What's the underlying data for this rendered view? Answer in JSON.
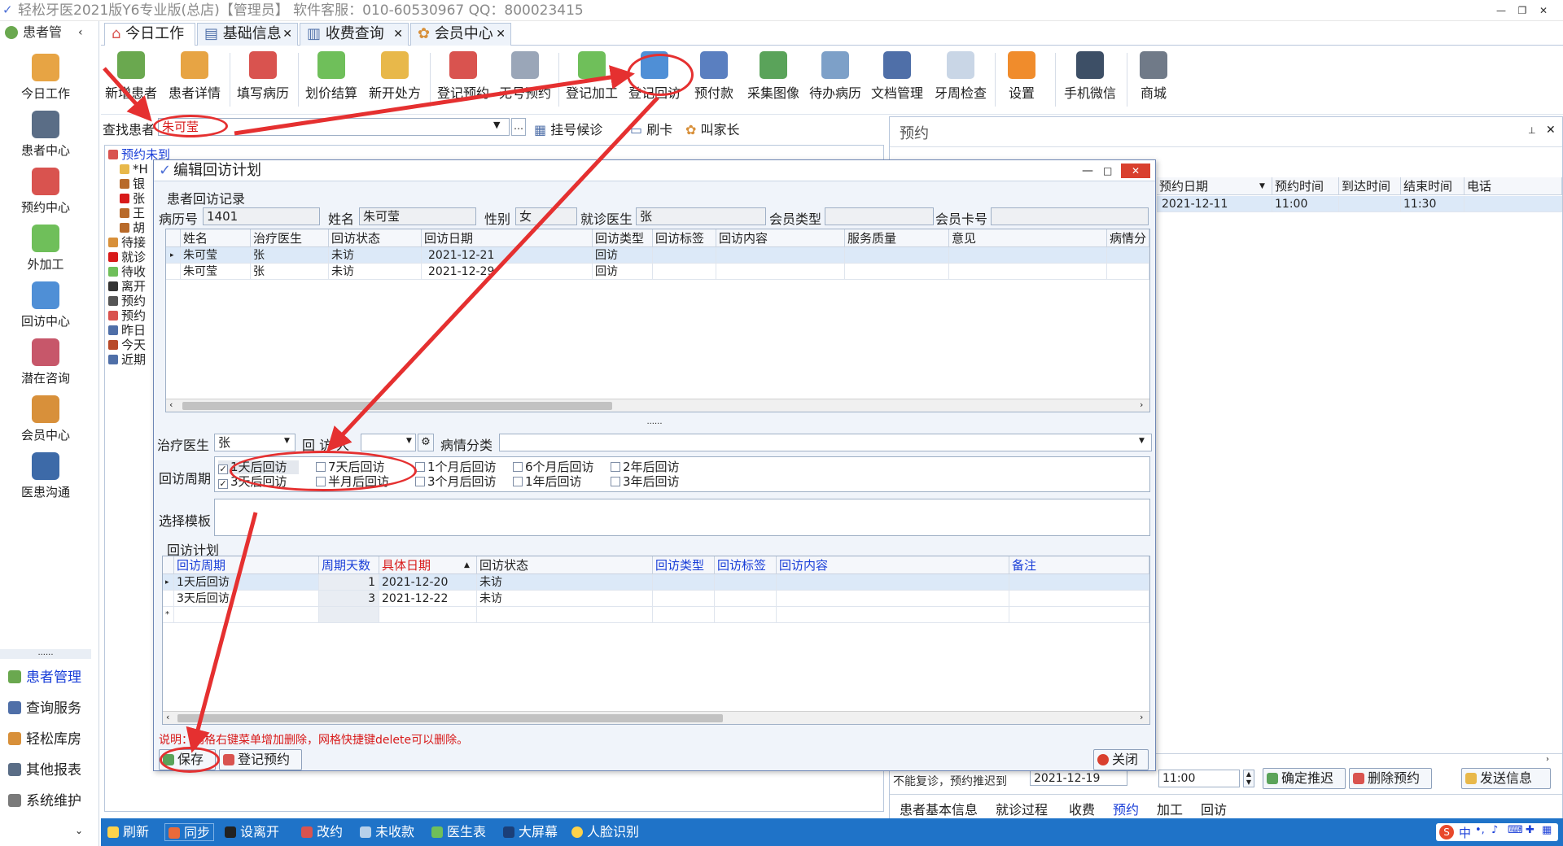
{
  "window": {
    "title": "轻松牙医2021版Y6专业版(总店)【管理员】    软件客服：010-60530967  QQ：800023415"
  },
  "sidebar": {
    "header": "患者管",
    "items": [
      "今日工作",
      "患者中心",
      "预约中心",
      "外加工",
      "回访中心",
      "潜在咨询",
      "会员中心",
      "医患沟通"
    ],
    "dots": "......",
    "bottom": [
      "患者管理",
      "查询服务",
      "轻松库房",
      "其他报表",
      "系统维护"
    ]
  },
  "tabs": [
    {
      "label": "今日工作",
      "closable": false
    },
    {
      "label": "基础信息",
      "closable": true
    },
    {
      "label": "收费查询",
      "closable": true
    },
    {
      "label": "会员中心",
      "closable": true
    }
  ],
  "toolbar": {
    "buttons": [
      "新增患者",
      "患者详情",
      "填写病历",
      "划价结算",
      "新开处方",
      "登记预约",
      "无号预约",
      "登记加工",
      "登记回访",
      "预付款",
      "采集图像",
      "待办病历",
      "文档管理",
      "牙周检查",
      "设置",
      "手机微信",
      "商城"
    ]
  },
  "search": {
    "label": "查找患者",
    "value": "朱可莹",
    "links": [
      "挂号候诊",
      "刷卡",
      "叫家长"
    ]
  },
  "tree": {
    "root": "预约未到",
    "rows": [
      "*H",
      "银",
      "张",
      "王",
      "胡",
      "待接",
      "就诊",
      "待收",
      "离开",
      "预约",
      "预约",
      "昨日",
      "今天",
      "近期"
    ]
  },
  "right_panel": {
    "title": "预约",
    "columns": [
      "预约日期",
      "预约时间",
      "到达时间",
      "结束时间",
      "电话"
    ],
    "row": [
      "2021-12-11",
      "11:00",
      "",
      "11:30",
      ""
    ],
    "hint": "不能复诊，预约推迟到",
    "postpone_date": "2021-12-19",
    "time_value": "11:00",
    "buttons": [
      "确定推迟",
      "删除预约",
      "发送信息"
    ],
    "bottom_tabs": [
      "患者基本信息",
      "就诊过程",
      "收费",
      "预约",
      "加工",
      "回访"
    ],
    "active_bottom_tab": "预约"
  },
  "dialog": {
    "title": "编辑回访计划",
    "section_records": "患者回访记录",
    "info": {
      "record_no_label": "病历号",
      "record_no": "1401",
      "name_label": "姓名",
      "name": "朱可莹",
      "gender_label": "性别",
      "gender": "女",
      "doctor_label": "就诊医生",
      "doctor": "张",
      "member_type_label": "会员类型",
      "member_type": "",
      "member_card_label": "会员卡号",
      "member_card": ""
    },
    "records_columns": [
      "姓名",
      "治疗医生",
      "回访状态",
      "回访日期",
      "回访类型",
      "回访标签",
      "回访内容",
      "服务质量",
      "意见",
      "病情分"
    ],
    "records_rows": [
      [
        "朱可莹",
        "张",
        "未访",
        "2021-12-21",
        "回访",
        "",
        "",
        "",
        "",
        ""
      ],
      [
        "朱可莹",
        "张",
        "未访",
        "2021-12-29",
        "回访",
        "",
        "",
        "",
        "",
        ""
      ]
    ],
    "splitter": "......",
    "form": {
      "doctor_label": "治疗医生",
      "doctor_value": "张",
      "visitor_label": "回 访 人",
      "visitor_value": "",
      "category_label": "病情分类",
      "category_value": "",
      "period_label": "回访周期",
      "template_label": "选择模板"
    },
    "periods": [
      {
        "label": "1天后回访",
        "checked": true
      },
      {
        "label": "3天后回访",
        "checked": true
      },
      {
        "label": "7天后回访",
        "checked": false
      },
      {
        "label": "半月后回访",
        "checked": false
      },
      {
        "label": "1个月后回访",
        "checked": false
      },
      {
        "label": "3个月后回访",
        "checked": false
      },
      {
        "label": "6个月后回访",
        "checked": false
      },
      {
        "label": "1年后回访",
        "checked": false
      },
      {
        "label": "2年后回访",
        "checked": false
      },
      {
        "label": "3年后回访",
        "checked": false
      }
    ],
    "plan_section": "回访计划",
    "plan_columns": [
      "回访周期",
      "周期天数",
      "具体日期",
      "回访状态",
      "回访类型",
      "回访标签",
      "回访内容",
      "备注"
    ],
    "plan_rows": [
      [
        "1天后回访",
        "1",
        "2021-12-20",
        "未访",
        "",
        "",
        "",
        ""
      ],
      [
        "3天后回访",
        "3",
        "2021-12-22",
        "未访",
        "",
        "",
        "",
        ""
      ]
    ],
    "note": "说明：网格右键菜单增加删除，网格快捷键delete可以删除。",
    "buttons": {
      "save": "保存",
      "register": "登记预约",
      "close": "关闭"
    }
  },
  "statusbar": {
    "items": [
      "刷新",
      "同步",
      "设离开",
      "改约",
      "未收款",
      "医生表",
      "大屏幕",
      "人脸识别"
    ]
  },
  "tray": {
    "ime": "中"
  },
  "colors": {
    "statusbar": "#1f73c8",
    "annotation": "#e53030",
    "link_blue": "#1a3fd8",
    "note_red": "#d81a1a"
  }
}
